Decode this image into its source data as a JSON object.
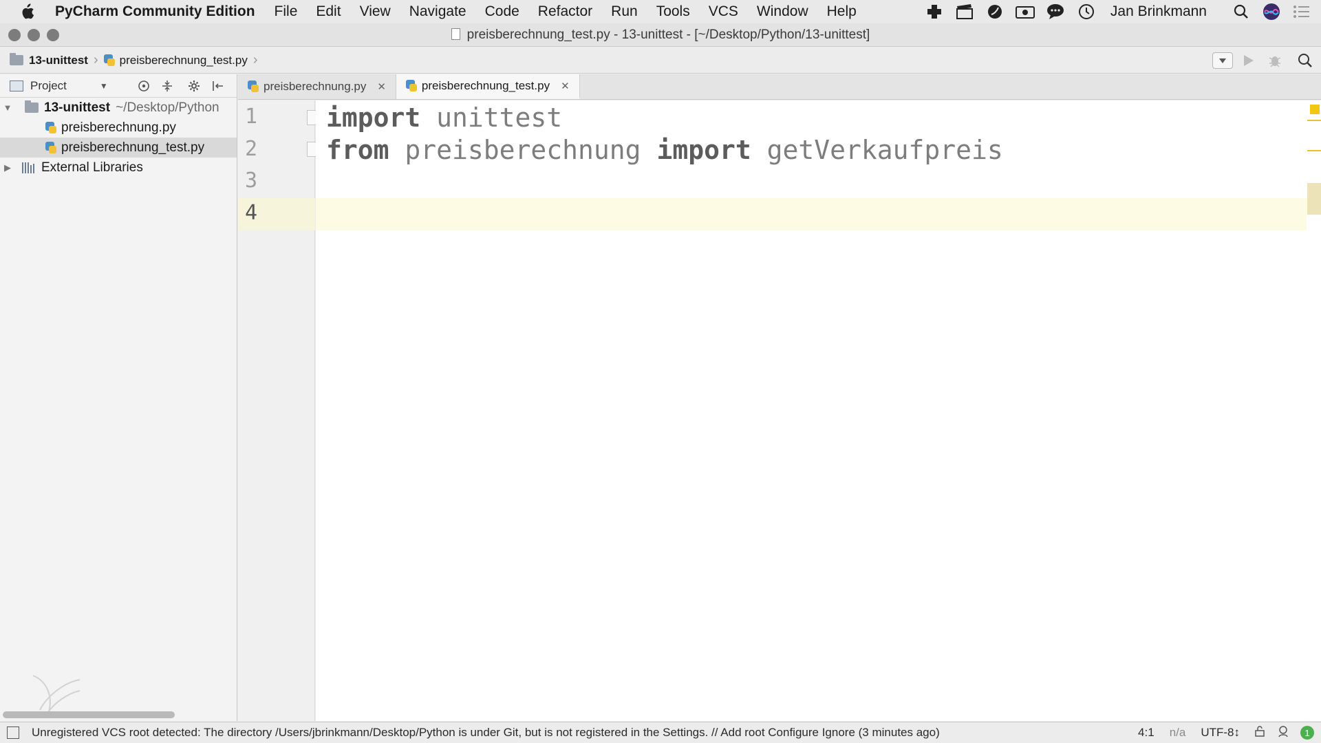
{
  "menubar": {
    "app_name": "PyCharm Community Edition",
    "items": [
      "File",
      "Edit",
      "View",
      "Navigate",
      "Code",
      "Refactor",
      "Run",
      "Tools",
      "VCS",
      "Window",
      "Help"
    ],
    "user": "Jan Brinkmann"
  },
  "window": {
    "title": "preisberechnung_test.py - 13-unittest - [~/Desktop/Python/13-unittest]"
  },
  "navbar": {
    "crumbs": [
      "13-unittest",
      "preisberechnung_test.py"
    ]
  },
  "project": {
    "header": "Project",
    "root_name": "13-unittest",
    "root_path": "~/Desktop/Python",
    "files": [
      "preisberechnung.py",
      "preisberechnung_test.py"
    ],
    "selected_file": "preisberechnung_test.py",
    "external": "External Libraries"
  },
  "tabs": [
    {
      "label": "preisberechnung.py",
      "active": false
    },
    {
      "label": "preisberechnung_test.py",
      "active": true
    }
  ],
  "editor": {
    "lines": [
      {
        "num": "1",
        "kw1": "import",
        "text1": " unittest",
        "kw2": "",
        "text2": ""
      },
      {
        "num": "2",
        "kw1": "from",
        "text1": " preisberechnung ",
        "kw2": "import",
        "text2": " getVerkaufpreis"
      },
      {
        "num": "3",
        "kw1": "",
        "text1": "",
        "kw2": "",
        "text2": ""
      },
      {
        "num": "4",
        "kw1": "",
        "text1": "",
        "kw2": "",
        "text2": ""
      }
    ],
    "current_line": "4"
  },
  "statusbar": {
    "message": "Unregistered VCS root detected: The directory /Users/jbrinkmann/Desktop/Python is under Git, but is not registered in the Settings. // Add root  Configure  Ignore (3 minutes ago)",
    "position": "4:1",
    "vcs": "n/a",
    "encoding": "UTF-8↕",
    "notifications": "1"
  },
  "colors": {
    "accent_yellow": "#f0c814",
    "caret_line": "#fdfbe3",
    "notification_green": "#4caf50"
  }
}
